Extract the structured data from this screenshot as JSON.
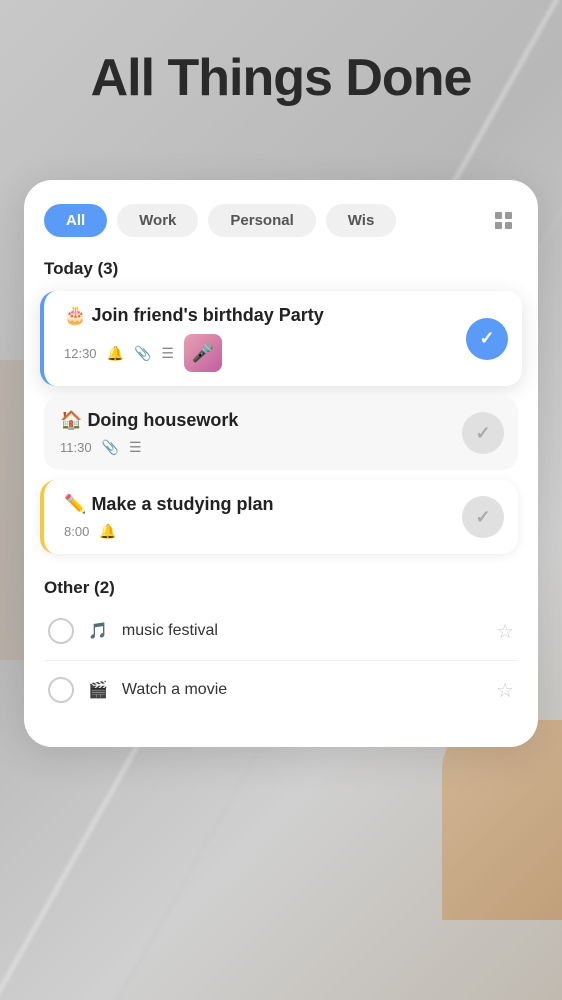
{
  "app": {
    "title": "All Things Done"
  },
  "filters": {
    "tabs": [
      {
        "id": "all",
        "label": "All",
        "active": true
      },
      {
        "id": "work",
        "label": "Work",
        "active": false
      },
      {
        "id": "personal",
        "label": "Personal",
        "active": false
      },
      {
        "id": "wish",
        "label": "Wis",
        "active": false
      }
    ]
  },
  "today": {
    "header": "Today (3)",
    "tasks": [
      {
        "id": "task1",
        "emoji": "🎂",
        "title": "Join friend's birthday Party",
        "time": "12:30",
        "has_bell": true,
        "has_clip": true,
        "has_list": true,
        "has_thumb": true,
        "checked": true,
        "style": "highlighted"
      },
      {
        "id": "task2",
        "emoji": "🏠",
        "title": "Doing housework",
        "time": "11:30",
        "has_bell": false,
        "has_clip": true,
        "has_list": true,
        "has_thumb": false,
        "checked": false,
        "style": "normal"
      },
      {
        "id": "task3",
        "emoji": "✏️",
        "title": "Make a studying plan",
        "time": "8:00",
        "has_bell": true,
        "has_clip": false,
        "has_list": false,
        "has_thumb": false,
        "checked": false,
        "style": "yellow"
      }
    ]
  },
  "other": {
    "header": "Other (2)",
    "tasks": [
      {
        "id": "other1",
        "emoji": "🎵",
        "title": "music festival",
        "starred": false
      },
      {
        "id": "other2",
        "emoji": "🎬",
        "title": "Watch a movie",
        "starred": false
      }
    ]
  }
}
